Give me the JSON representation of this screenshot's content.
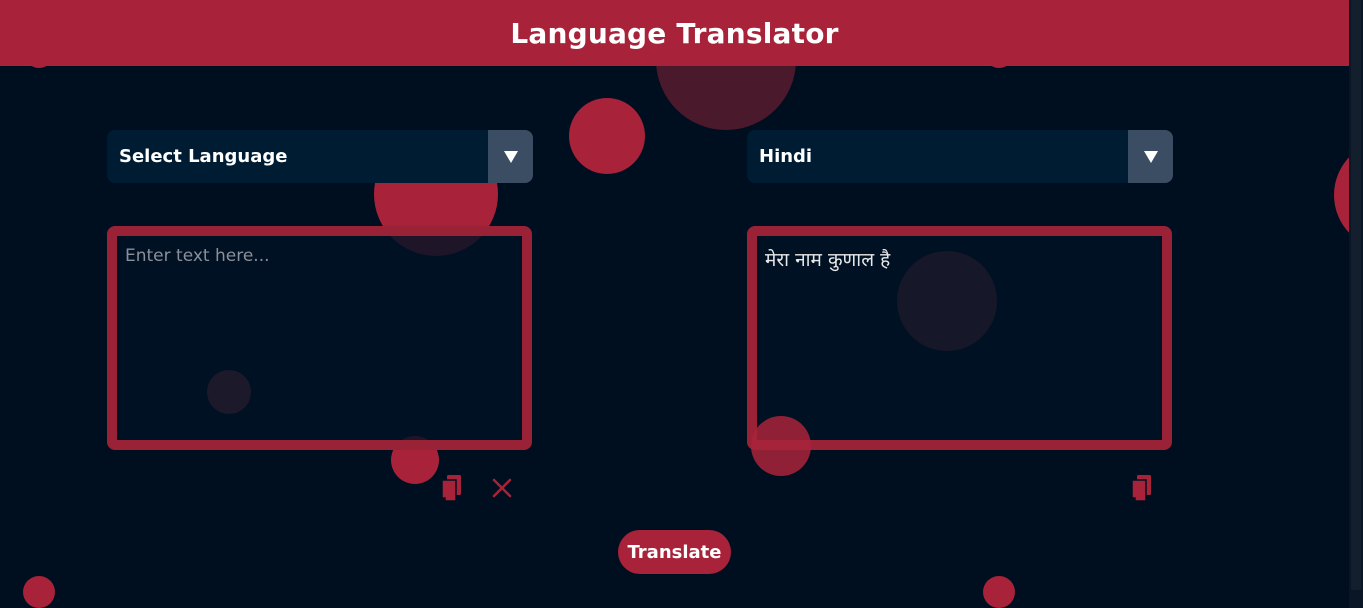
{
  "header": {
    "title": "Language Translator"
  },
  "source": {
    "language_label": "Select Language",
    "input_placeholder": "Enter text here...",
    "input_value": ""
  },
  "target": {
    "language_label": "Hindi",
    "output_value": "मेरा नाम कुणाल है"
  },
  "actions": {
    "translate_label": "Translate"
  },
  "icons": {
    "source_copy": "copy-icon",
    "source_clear": "close-icon",
    "target_copy": "copy-icon",
    "dropdown": "caret-down-icon"
  },
  "colors": {
    "accent": "#a8233a",
    "background": "#000f1f",
    "select_bg": "#001c33",
    "select_arrow_bg": "#3a4d63",
    "textbox_border": "#9a2236"
  }
}
